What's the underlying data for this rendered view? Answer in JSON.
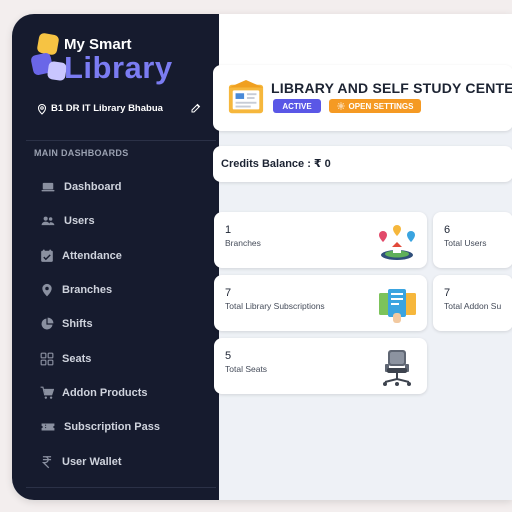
{
  "brand": {
    "line1": "My Smart",
    "line2": "Library"
  },
  "branch": {
    "name": "B1 DR IT Library Bhabua"
  },
  "sidebar": {
    "section_title": "MAIN DASHBOARDS",
    "items": [
      {
        "label": "Dashboard",
        "icon": "laptop-icon"
      },
      {
        "label": "Users",
        "icon": "users-icon"
      },
      {
        "label": "Attendance",
        "icon": "attendance-icon"
      },
      {
        "label": "Branches",
        "icon": "map-pin-icon"
      },
      {
        "label": "Shifts",
        "icon": "pie-chart-icon"
      },
      {
        "label": "Seats",
        "icon": "grid-icon"
      },
      {
        "label": "Addon Products",
        "icon": "cart-icon"
      },
      {
        "label": "Subscription Pass",
        "icon": "ticket-icon"
      },
      {
        "label": "User Wallet",
        "icon": "rupee-icon"
      }
    ]
  },
  "header": {
    "title": "LIBRARY AND SELF STUDY CENTE",
    "status_badge": "ACTIVE",
    "settings_button": "OPEN SETTINGS"
  },
  "credits": {
    "text": "Credits Balance : ₹ 0"
  },
  "stats": [
    {
      "value": "1",
      "label": "Branches"
    },
    {
      "value": "6",
      "label": "Total Users"
    },
    {
      "value": "7",
      "label": "Total Library Subscriptions"
    },
    {
      "value": "7",
      "label": "Total Addon Su"
    },
    {
      "value": "5",
      "label": "Total Seats"
    }
  ],
  "colors": {
    "sidebar_bg": "#161b2e",
    "accent": "#5a57e6",
    "brand_purple": "#7b7cf2",
    "warning": "#f59a23",
    "page_bg": "#eef1f6"
  }
}
